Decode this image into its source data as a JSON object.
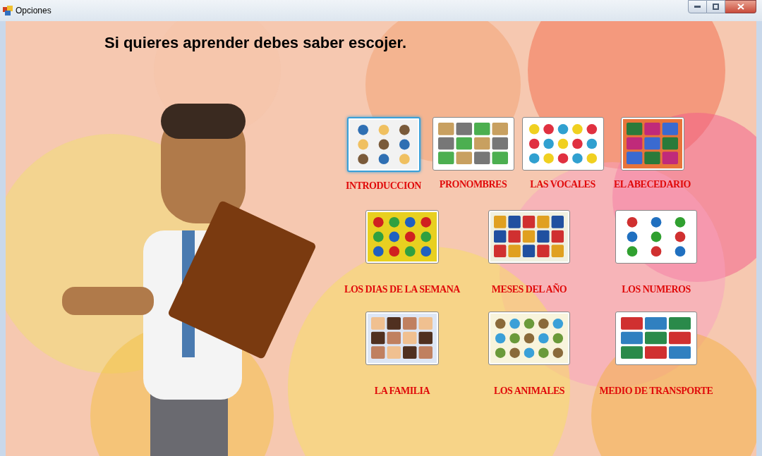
{
  "window": {
    "title": "Opciones"
  },
  "heading": "Si quieres aprender debes saber escojer.",
  "rows": [
    {
      "tiles": [
        {
          "label": "INTRODUCCION",
          "selected": true
        },
        {
          "label": "PRONOMBRES",
          "selected": false
        },
        {
          "label": "LAS VOCALES",
          "selected": false
        },
        {
          "label": "EL ABECEDARIO",
          "selected": false
        }
      ]
    },
    {
      "tiles": [
        {
          "label": "LOS DIAS DE LA SEMANA",
          "selected": false
        },
        {
          "label": "MESES DEL AÑO",
          "selected": false
        },
        {
          "label": "LOS NUMEROS",
          "selected": false
        }
      ]
    },
    {
      "tiles": [
        {
          "label": "LA FAMILIA",
          "selected": false
        },
        {
          "label": "LOS ANIMALES",
          "selected": false
        },
        {
          "label": "MEDIO DE TRANSPORTE",
          "selected": false
        }
      ]
    }
  ]
}
